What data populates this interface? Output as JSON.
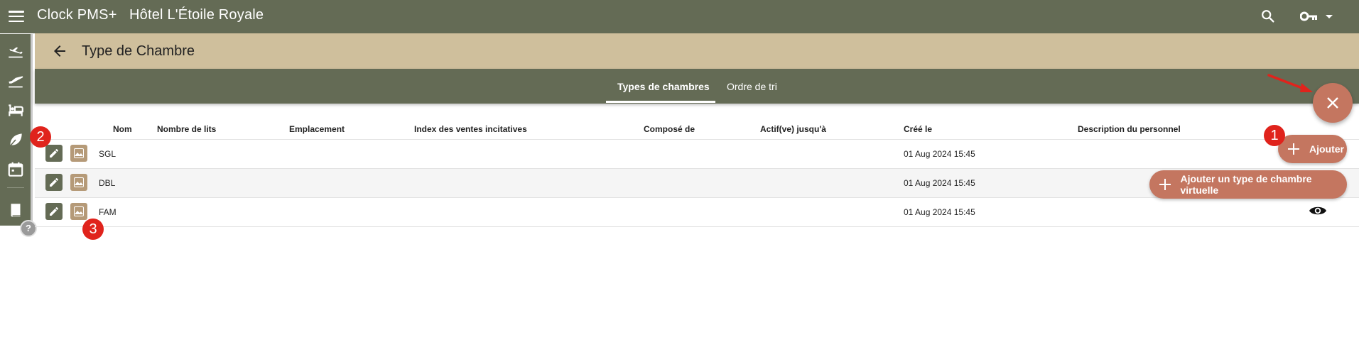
{
  "topbar": {
    "app_title": "Clock PMS+",
    "hotel_name": "Hôtel L'Étoile Royale",
    "icons": [
      "menu-icon",
      "search-icon",
      "key-icon",
      "caret-down-icon"
    ]
  },
  "sidebar": {
    "items": [
      {
        "icon": "arrivals-icon"
      },
      {
        "icon": "departures-icon"
      },
      {
        "icon": "bed-icon"
      },
      {
        "icon": "leaf-icon"
      },
      {
        "icon": "calendar-icon"
      },
      {
        "icon": "book-icon"
      }
    ],
    "help_label": "?"
  },
  "page": {
    "title": "Type de Chambre"
  },
  "tabs": [
    {
      "label": "Types de chambres",
      "active": true
    },
    {
      "label": "Ordre de tri",
      "active": false
    }
  ],
  "table": {
    "columns": [
      "Nom",
      "Nombre de lits",
      "Emplacement",
      "Index des ventes incitatives",
      "Composé de",
      "Actif(ve) jusqu'à",
      "Créé le",
      "Description du personnel"
    ],
    "rows": [
      {
        "nom": "SGL",
        "created": "01 Aug 2024 15:45"
      },
      {
        "nom": "DBL",
        "created": "01 Aug 2024 15:45"
      },
      {
        "nom": "FAM",
        "created": "01 Aug 2024 15:45"
      }
    ]
  },
  "actions": {
    "add_label": "Ajouter",
    "add_virtual_label": "Ajouter un type de chambre virtuelle"
  },
  "annotations": {
    "badges": [
      "1",
      "2",
      "3"
    ]
  },
  "colors": {
    "primary": "#646b55",
    "secondary": "#cfbf9c",
    "accent": "#c47660",
    "badge": "#e0231c"
  }
}
